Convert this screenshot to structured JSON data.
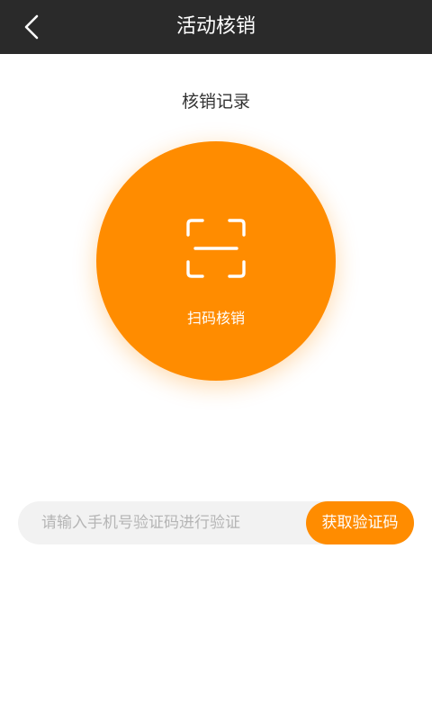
{
  "header": {
    "title": "活动核销",
    "back_icon": "chevron-left-icon"
  },
  "records_link": {
    "label": "核销记录"
  },
  "scan": {
    "label": "扫码核销",
    "icon": "scan-frame-icon",
    "color": "#ff8c00"
  },
  "verify": {
    "placeholder": "请输入手机号验证码进行验证",
    "value": "",
    "button_label": "获取验证码"
  },
  "colors": {
    "topbar": "#2a2a2a",
    "accent": "#ff8c00",
    "input_bg": "#f2f2f2"
  }
}
